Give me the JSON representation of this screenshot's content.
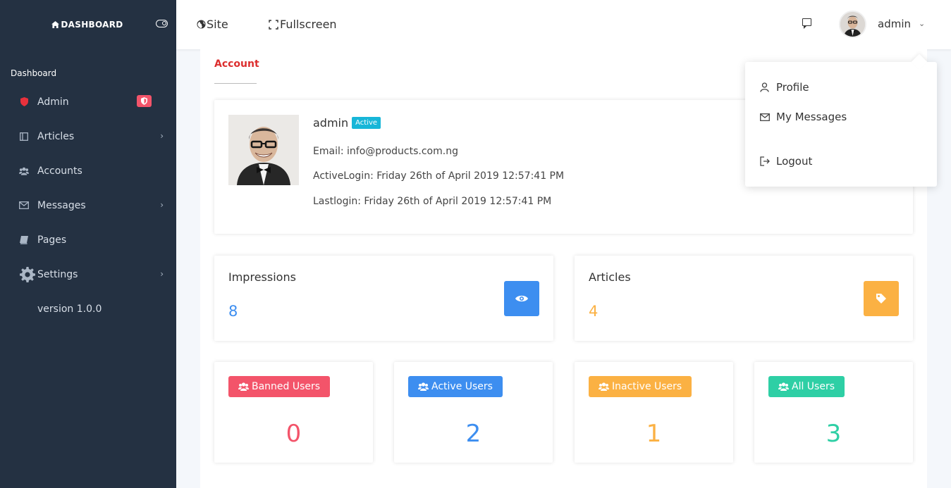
{
  "colors": {
    "sidebar_bg": "#243142",
    "accent_red": "#dc2e2e",
    "badge_pink": "#f3546a",
    "blue": "#3d8ef0",
    "orange": "#fbb143",
    "teal": "#2ecfa5",
    "cyan_badge": "#17b6d8"
  },
  "sidebar": {
    "brand": "DASHBOARD",
    "section_title": "Dashboard",
    "items": [
      {
        "label": "Admin",
        "icon": "shield-icon"
      },
      {
        "label": "Articles",
        "icon": "book-icon"
      },
      {
        "label": "Accounts",
        "icon": "users-icon"
      },
      {
        "label": "Messages",
        "icon": "envelope-icon"
      },
      {
        "label": "Pages",
        "icon": "pages-icon"
      },
      {
        "label": "Settings",
        "icon": "gear-icon"
      }
    ],
    "version": "version 1.0.0"
  },
  "topbar": {
    "site_label": "Site",
    "fullscreen_label": "Fullscreen",
    "user_name": "admin"
  },
  "main": {
    "tab_label": "Account",
    "profile": {
      "name": "admin",
      "status": "Active",
      "email": "Email: info@products.com.ng",
      "active_login": "ActiveLogin: Friday 26th of April 2019 12:57:41 PM",
      "last_login": "Lastlogin: Friday 26th of April 2019 12:57:41 PM"
    },
    "stats": {
      "impressions_label": "Impressions",
      "impressions_value": "8",
      "articles_label": "Articles",
      "articles_value": "4"
    },
    "users": [
      {
        "label": "Banned Users",
        "count": "0"
      },
      {
        "label": "Active Users",
        "count": "2"
      },
      {
        "label": "Inactive Users",
        "count": "1"
      },
      {
        "label": "All Users",
        "count": "3"
      }
    ]
  },
  "dropdown": {
    "profile": "Profile",
    "messages": "My Messages",
    "logout": "Logout"
  }
}
